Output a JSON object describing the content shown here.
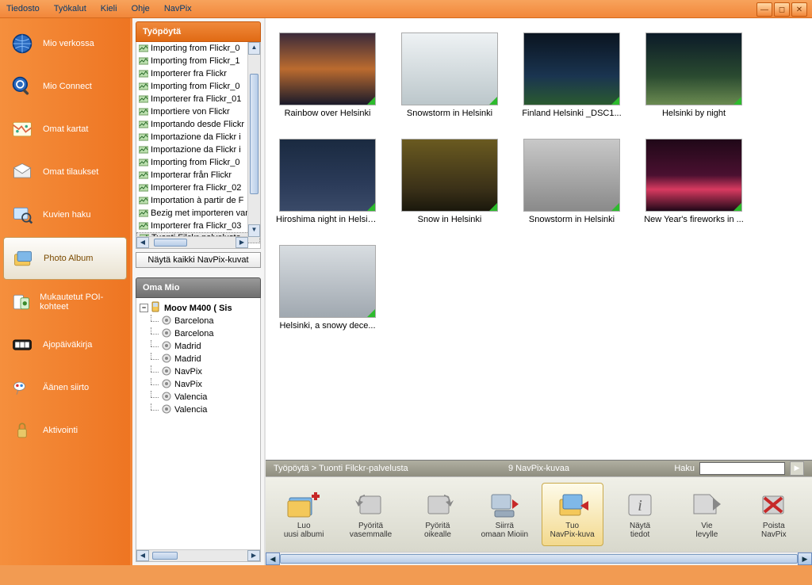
{
  "menubar": {
    "items": [
      "Tiedosto",
      "Työkalut",
      "Kieli",
      "Ohje",
      "NavPix"
    ]
  },
  "sidebar": {
    "items": [
      {
        "label": "Mio verkossa"
      },
      {
        "label": "Mio Connect"
      },
      {
        "label": "Omat kartat"
      },
      {
        "label": "Omat tilaukset"
      },
      {
        "label": "Kuvien haku"
      },
      {
        "label": "Photo Album",
        "active": true
      },
      {
        "label": "Mukautetut POI-kohteet"
      },
      {
        "label": "Ajopäiväkirja"
      },
      {
        "label": "Äänen siirto"
      },
      {
        "label": "Aktivointi"
      }
    ]
  },
  "desktop_panel": {
    "title": "Työpöytä",
    "items": [
      "Importing from Flickr_0",
      "Importing from Flickr_1",
      "Importerer fra Flickr",
      "Importing from Flickr_0",
      "Importerer fra Flickr_01",
      "Importiere von Flickr",
      "Importando desde Flickr",
      "Importazione da Flickr i",
      "Importazione da Flickr i",
      "Importing from Flickr_0",
      "Importerar från Flickr",
      "Importerer fra Flickr_02",
      "Importation à partir de F",
      "Bezig met importeren van",
      "Importerer fra Flickr_03",
      "Tuonti Filckr-palvelusta"
    ],
    "selected_index": 15,
    "show_all": "Näytä kaikki NavPix-kuvat"
  },
  "mio_panel": {
    "title": "Oma Mio",
    "root": "Moov M400 ( Sis",
    "children": [
      "Barcelona",
      "Barcelona",
      "Madrid",
      "Madrid",
      "NavPix",
      "NavPix",
      "Valencia",
      "Valencia"
    ]
  },
  "thumbs": [
    {
      "label": "Rainbow over Helsinki",
      "cls": "ph-sunset"
    },
    {
      "label": "Snowstorm in Helsinki",
      "cls": "ph-snow"
    },
    {
      "label": "Finland Helsinki _DSC1...",
      "cls": "ph-night"
    },
    {
      "label": "Helsinki by night",
      "cls": "ph-street"
    },
    {
      "label": "Hiroshima night in Helsin...",
      "cls": "ph-water"
    },
    {
      "label": "Snow in Helsinki",
      "cls": "ph-yellow"
    },
    {
      "label": "Snowstorm in Helsinki",
      "cls": "ph-grey"
    },
    {
      "label": "New Year's fireworks in ...",
      "cls": "ph-fire"
    },
    {
      "label": "Helsinki, a snowy dece...",
      "cls": "ph-snow2"
    }
  ],
  "breadcrumb": {
    "path": "Työpöytä > Tuonti Filckr-palvelusta",
    "count": "9 NavPix-kuvaa",
    "search_label": "Haku"
  },
  "toolbar": {
    "items": [
      {
        "label": "Luo uusi albumi"
      },
      {
        "label": "Pyöritä vasemmalle"
      },
      {
        "label": "Pyöritä oikealle"
      },
      {
        "label": "Siirrä omaan Mioiin"
      },
      {
        "label": "Tuo NavPix-kuva",
        "active": true
      },
      {
        "label": "Näytä tiedot"
      },
      {
        "label": "Vie levylle"
      },
      {
        "label": "Poista NavPix"
      }
    ]
  }
}
